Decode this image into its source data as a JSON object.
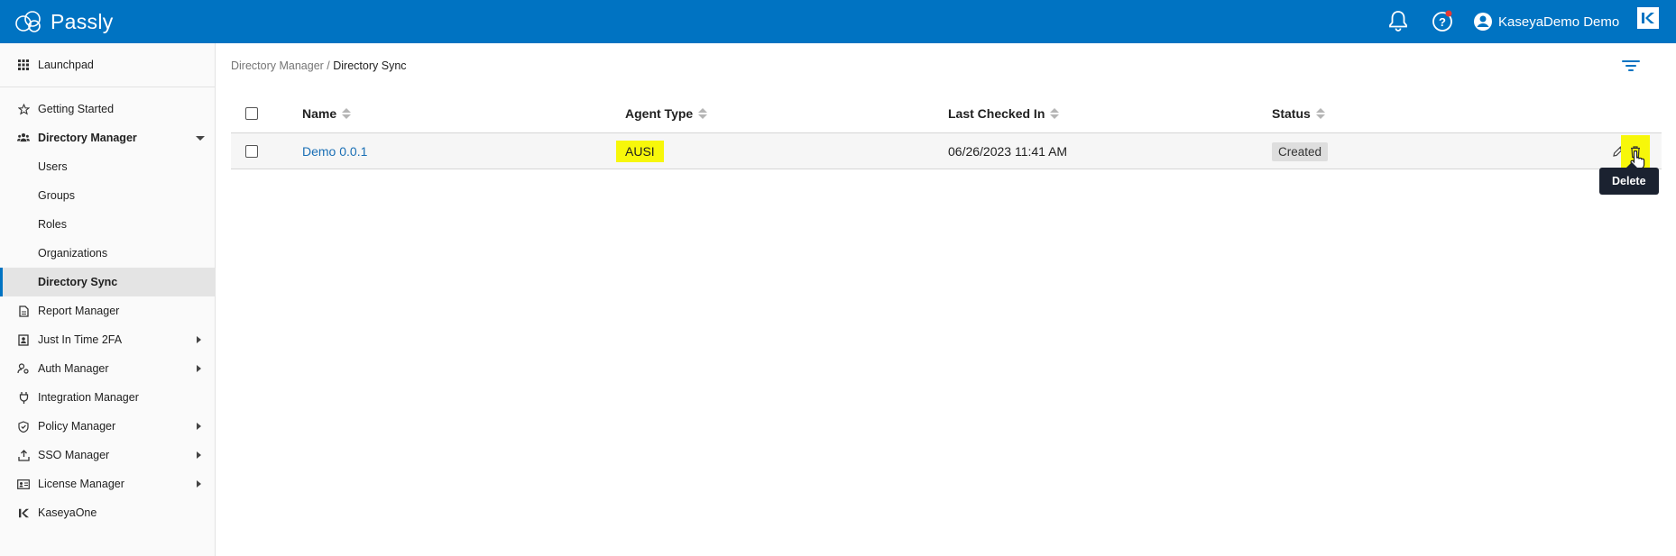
{
  "app": {
    "brand": "Passly",
    "user_name": "KaseyaDemo Demo",
    "brand_color": "#0073c2"
  },
  "sidebar": {
    "launchpad": "Launchpad",
    "items": [
      {
        "label": "Getting Started",
        "icon": "star-icon"
      },
      {
        "label": "Directory Manager",
        "icon": "users-icon",
        "expanded": true
      },
      {
        "label": "Users"
      },
      {
        "label": "Groups"
      },
      {
        "label": "Roles"
      },
      {
        "label": "Organizations"
      },
      {
        "label": "Directory Sync",
        "active": true
      },
      {
        "label": "Report Manager",
        "icon": "document-icon"
      },
      {
        "label": "Just In Time 2FA",
        "icon": "badge-icon",
        "has_submenu": true
      },
      {
        "label": "Auth Manager",
        "icon": "user-key-icon",
        "has_submenu": true
      },
      {
        "label": "Integration Manager",
        "icon": "plug-icon"
      },
      {
        "label": "Policy Manager",
        "icon": "shield-icon",
        "has_submenu": true
      },
      {
        "label": "SSO Manager",
        "icon": "upload-icon",
        "has_submenu": true
      },
      {
        "label": "License Manager",
        "icon": "id-card-icon",
        "has_submenu": true
      },
      {
        "label": "KaseyaOne",
        "icon": "kaseya-icon"
      }
    ]
  },
  "breadcrumb": {
    "parent": "Directory Manager",
    "separator": " / ",
    "current": "Directory Sync"
  },
  "table": {
    "columns": [
      "Name",
      "Agent Type",
      "Last Checked In",
      "Status"
    ],
    "rows": [
      {
        "name": "Demo 0.0.1",
        "agent_type": "AUSI",
        "last_checked_in": "06/26/2023 11:41 AM",
        "status": "Created"
      }
    ]
  },
  "tooltip": {
    "delete": "Delete"
  }
}
